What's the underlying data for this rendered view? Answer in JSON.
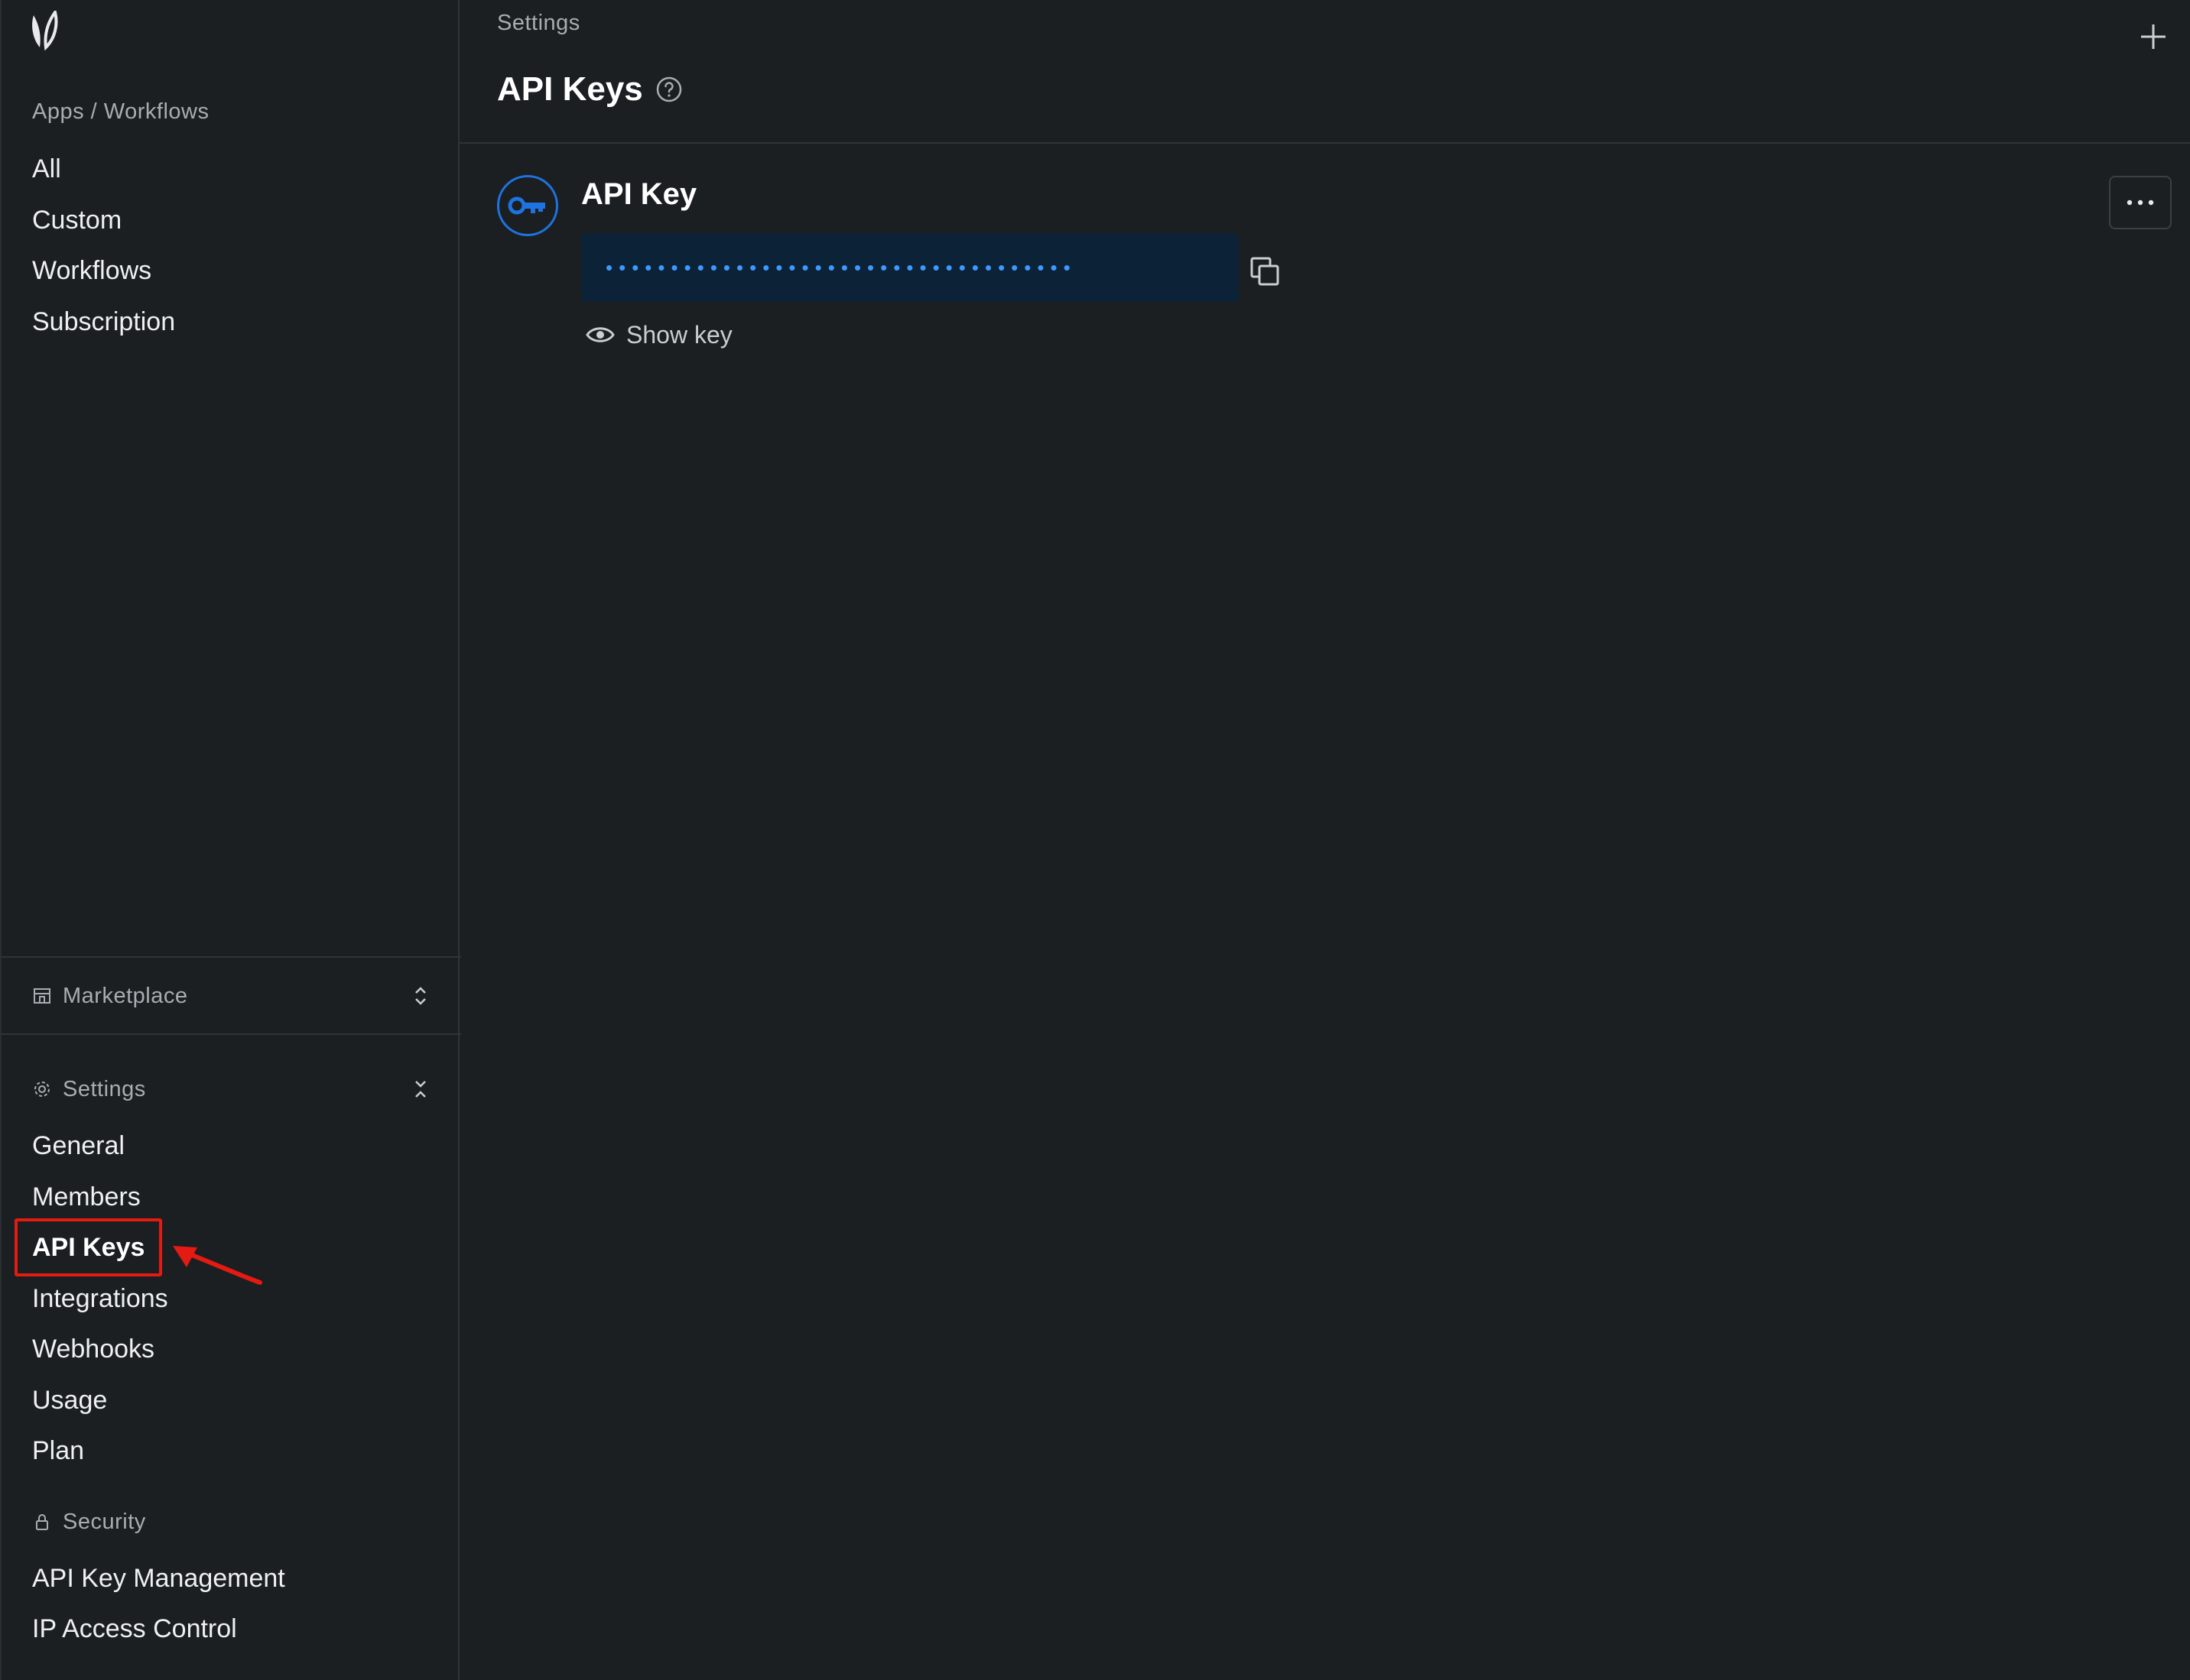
{
  "sidebar": {
    "apps_section_label": "Apps / Workflows",
    "apps_items": [
      "All",
      "Custom",
      "Workflows",
      "Subscription"
    ],
    "marketplace_label": "Marketplace",
    "settings_label": "Settings",
    "settings_items": [
      "General",
      "Members",
      "API Keys",
      "Integrations",
      "Webhooks",
      "Usage",
      "Plan"
    ],
    "active_item": "API Keys",
    "security_label": "Security",
    "security_items": [
      "API Key Management",
      "IP Access Control"
    ]
  },
  "header": {
    "breadcrumb": "Settings",
    "title": "API Keys"
  },
  "key_card": {
    "title": "API Key",
    "masked_value": "••••••••••••••••••••••••••••••••••••",
    "show_key_label": "Show key"
  },
  "colors": {
    "background": "#1b1f22",
    "accent": "#1e73e0",
    "key_field_bg": "#0c2236",
    "annotation": "#e31b12"
  },
  "icons": [
    "logo-icon",
    "help-icon",
    "add-icon",
    "key-icon",
    "copy-icon",
    "eye-icon",
    "more-icon",
    "store-icon",
    "gear-icon",
    "lock-icon",
    "chevron-updown-icon",
    "chevron-collapse-icon"
  ]
}
